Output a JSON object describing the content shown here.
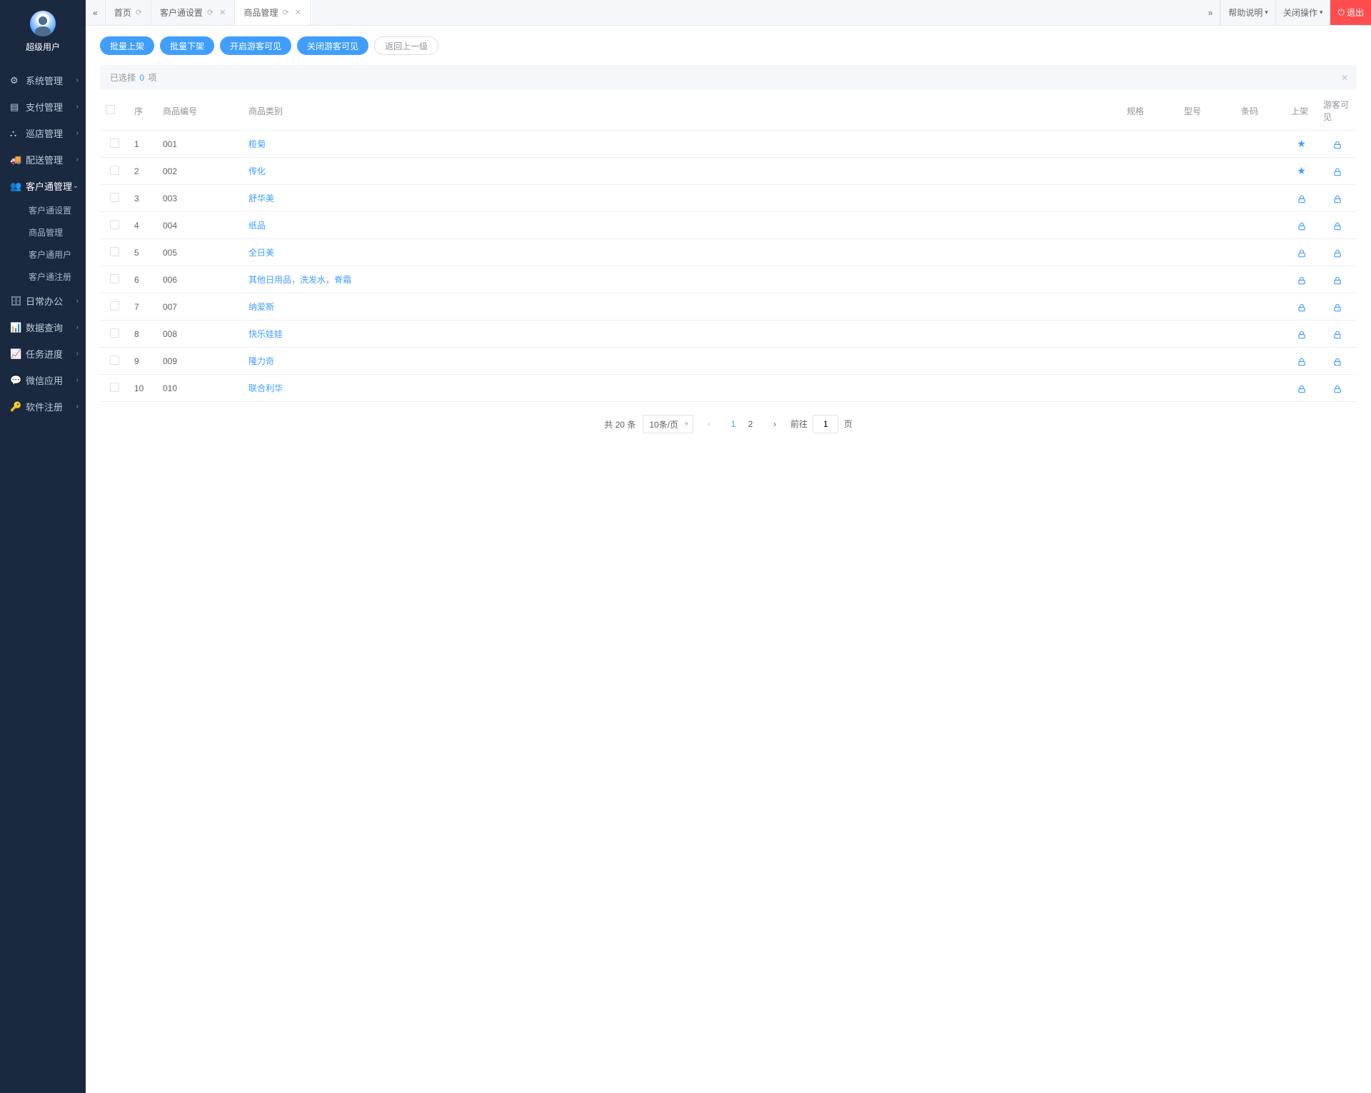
{
  "user": {
    "name": "超级用户"
  },
  "sidebar": {
    "items": [
      {
        "icon": "⚙",
        "label": "系统管理"
      },
      {
        "icon": "▤",
        "label": "支付管理"
      },
      {
        "icon": "⛬",
        "label": "巡店管理"
      },
      {
        "icon": "🚚",
        "label": "配送管理"
      },
      {
        "icon": "👥",
        "label": "客户通管理",
        "active": true,
        "children": [
          {
            "label": "客户通设置"
          },
          {
            "label": "商品管理"
          },
          {
            "label": "客户通用户"
          },
          {
            "label": "客户通注册"
          }
        ]
      },
      {
        "icon": "🗄",
        "label": "日常办公"
      },
      {
        "icon": "📊",
        "label": "数据查询"
      },
      {
        "icon": "📈",
        "label": "任务进度"
      },
      {
        "icon": "💬",
        "label": "微信应用"
      },
      {
        "icon": "🔑",
        "label": "软件注册"
      }
    ]
  },
  "tabs": [
    {
      "label": "首页",
      "refresh": true,
      "closable": false
    },
    {
      "label": "客户通设置",
      "refresh": true,
      "closable": true
    },
    {
      "label": "商品管理",
      "refresh": true,
      "closable": true,
      "active": true
    }
  ],
  "topbar_right": {
    "help": "帮助说明",
    "close_ops": "关闭操作",
    "exit": "退出"
  },
  "actions": {
    "bulk_on": "批量上架",
    "bulk_off": "批量下架",
    "guest_on": "开启游客可见",
    "guest_off": "关闭游客可见",
    "back": "返回上一级"
  },
  "selection_bar": {
    "prefix": "已选择",
    "count": "0",
    "suffix": "项"
  },
  "table": {
    "headers": {
      "seq": "序",
      "code": "商品编号",
      "category": "商品类别",
      "spec": "规格",
      "model": "型号",
      "barcode": "条码",
      "onsale": "上架",
      "guest": "游客可见"
    },
    "rows": [
      {
        "seq": "1",
        "code": "001",
        "category": "榄菊",
        "onsale_star": true
      },
      {
        "seq": "2",
        "code": "002",
        "category": "传化",
        "onsale_star": true
      },
      {
        "seq": "3",
        "code": "003",
        "category": "舒华美",
        "onsale_star": false
      },
      {
        "seq": "4",
        "code": "004",
        "category": "纸品",
        "onsale_star": false
      },
      {
        "seq": "5",
        "code": "005",
        "category": "全日美",
        "onsale_star": false
      },
      {
        "seq": "6",
        "code": "006",
        "category": "其他日用品，洗发水，脊霜",
        "onsale_star": false
      },
      {
        "seq": "7",
        "code": "007",
        "category": "纳爱斯",
        "onsale_star": false
      },
      {
        "seq": "8",
        "code": "008",
        "category": "快乐娃娃",
        "onsale_star": false
      },
      {
        "seq": "9",
        "code": "009",
        "category": "隆力奇",
        "onsale_star": false
      },
      {
        "seq": "10",
        "code": "010",
        "category": "联合利华",
        "onsale_star": false
      }
    ]
  },
  "pagination": {
    "total_prefix": "共",
    "total": "20",
    "total_suffix": "条",
    "per_page": "10条/页",
    "pages": [
      "1",
      "2"
    ],
    "current": "1",
    "jump_prefix": "前往",
    "jump_value": "1",
    "jump_suffix": "页"
  }
}
